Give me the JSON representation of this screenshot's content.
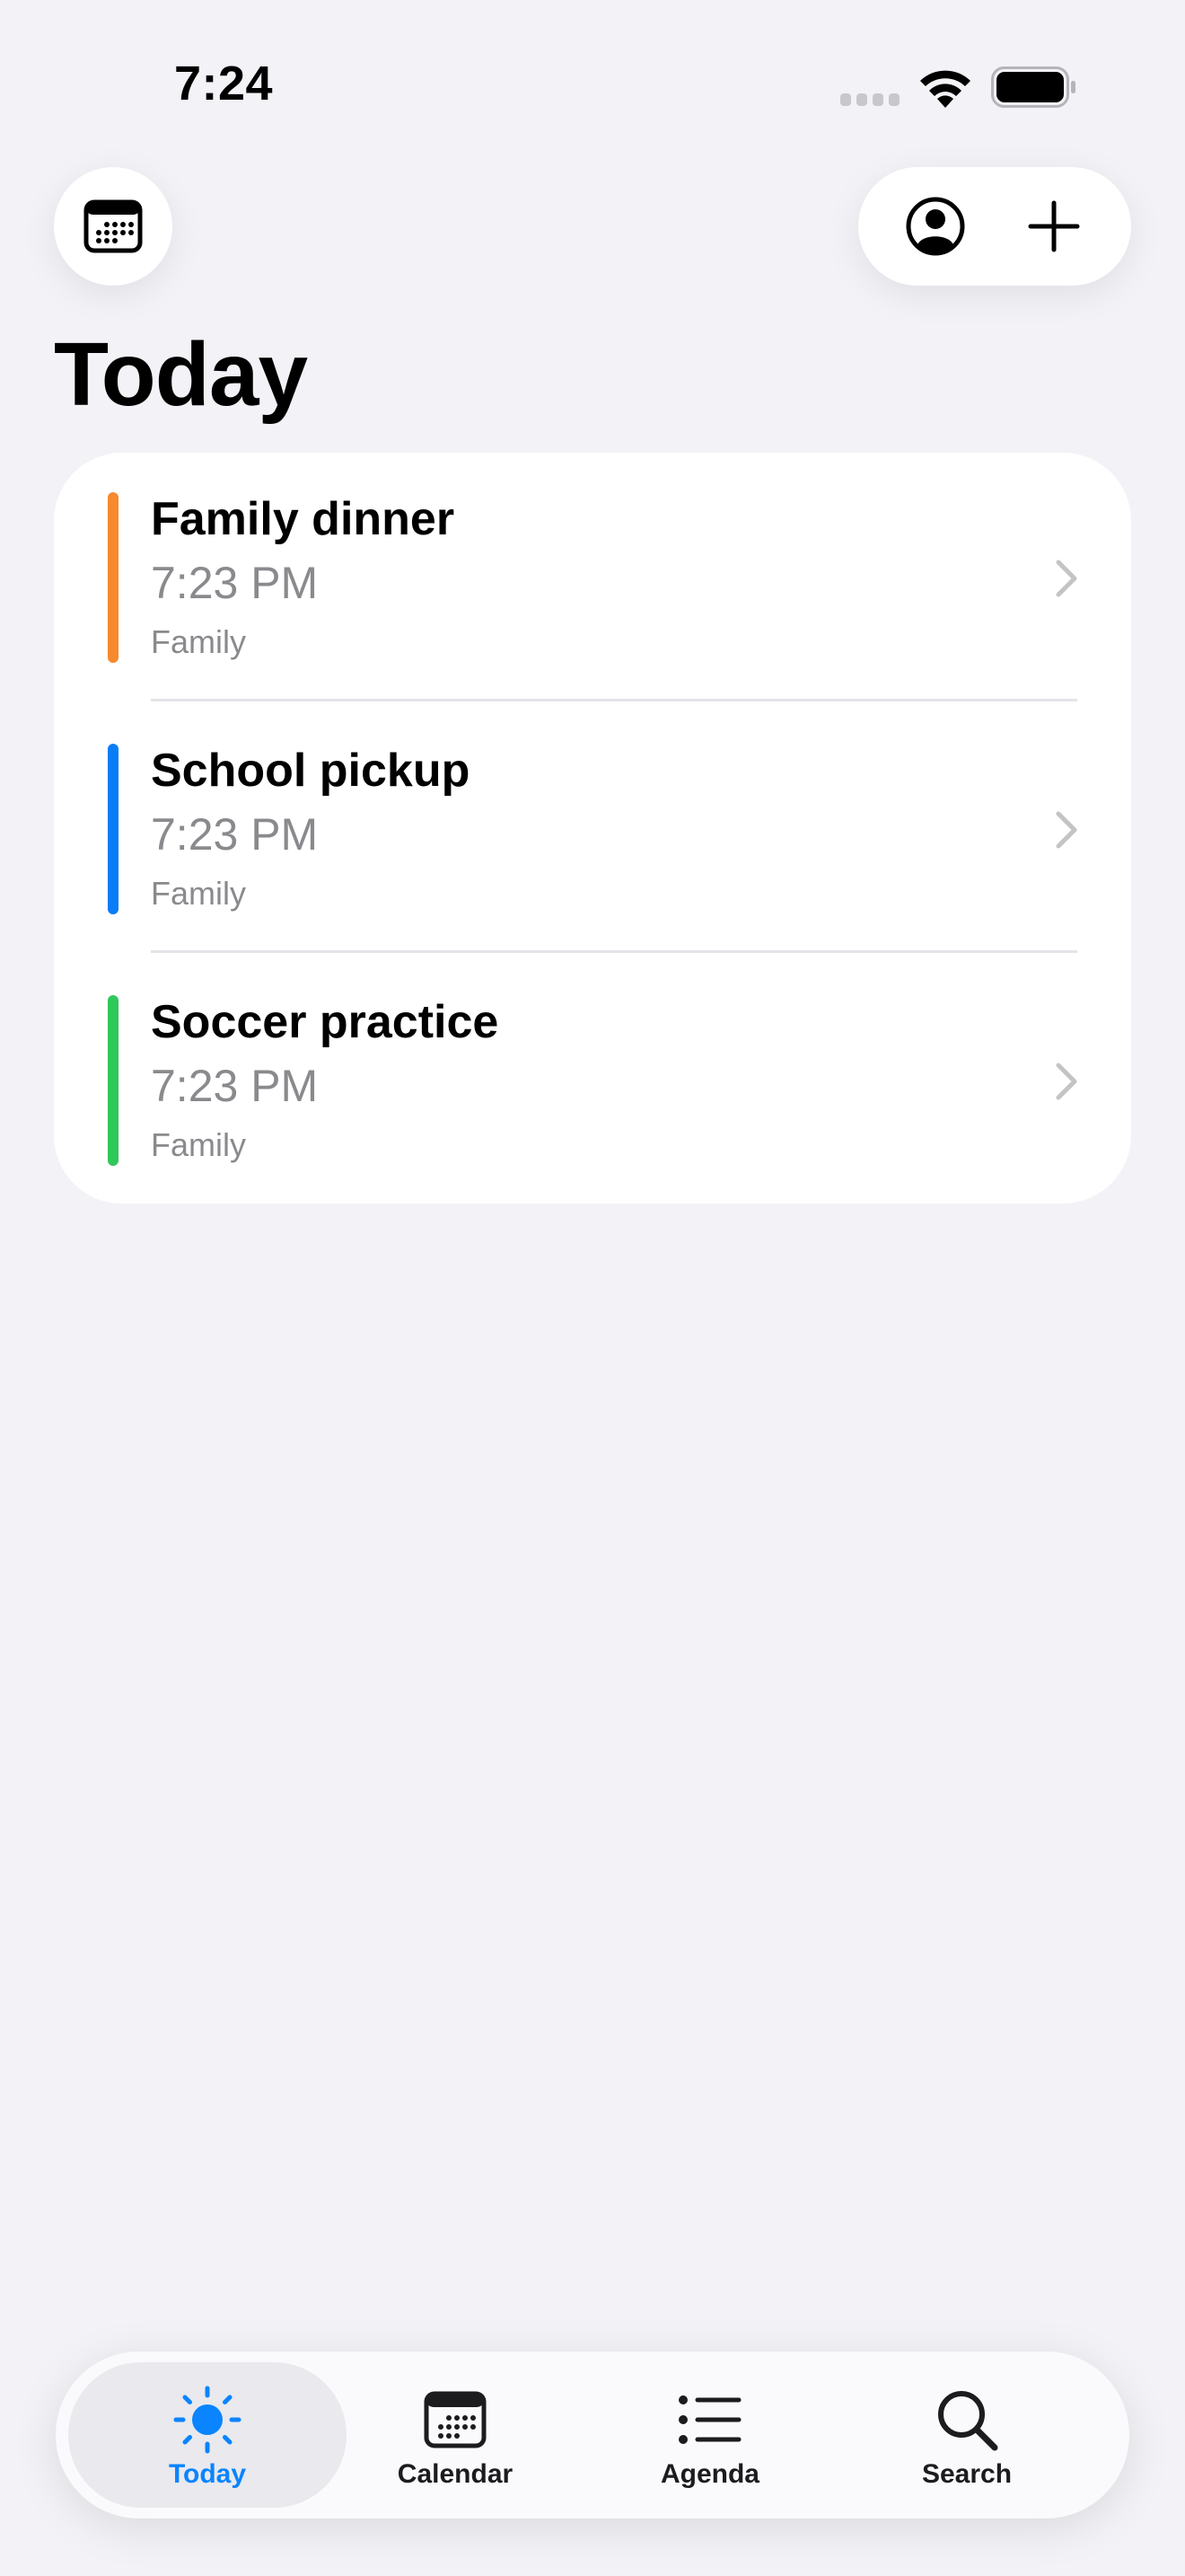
{
  "status_bar": {
    "time": "7:24"
  },
  "header": {
    "title": "Today"
  },
  "events": [
    {
      "title": "Family dinner",
      "time": "7:23 PM",
      "calendar": "Family",
      "color": "#F7892E"
    },
    {
      "title": "School pickup",
      "time": "7:23 PM",
      "calendar": "Family",
      "color": "#0A7CF5"
    },
    {
      "title": "Soccer practice",
      "time": "7:23 PM",
      "calendar": "Family",
      "color": "#30C75B"
    }
  ],
  "tabbar": {
    "tabs": [
      {
        "label": "Today",
        "icon": "sun-icon",
        "active": true
      },
      {
        "label": "Calendar",
        "icon": "calendar-icon",
        "active": false
      },
      {
        "label": "Agenda",
        "icon": "list-icon",
        "active": false
      },
      {
        "label": "Search",
        "icon": "search-icon",
        "active": false
      }
    ]
  },
  "colors": {
    "accent": "#0A84FF",
    "background": "#F2F2F7",
    "secondary_text": "#8A8A8E"
  }
}
